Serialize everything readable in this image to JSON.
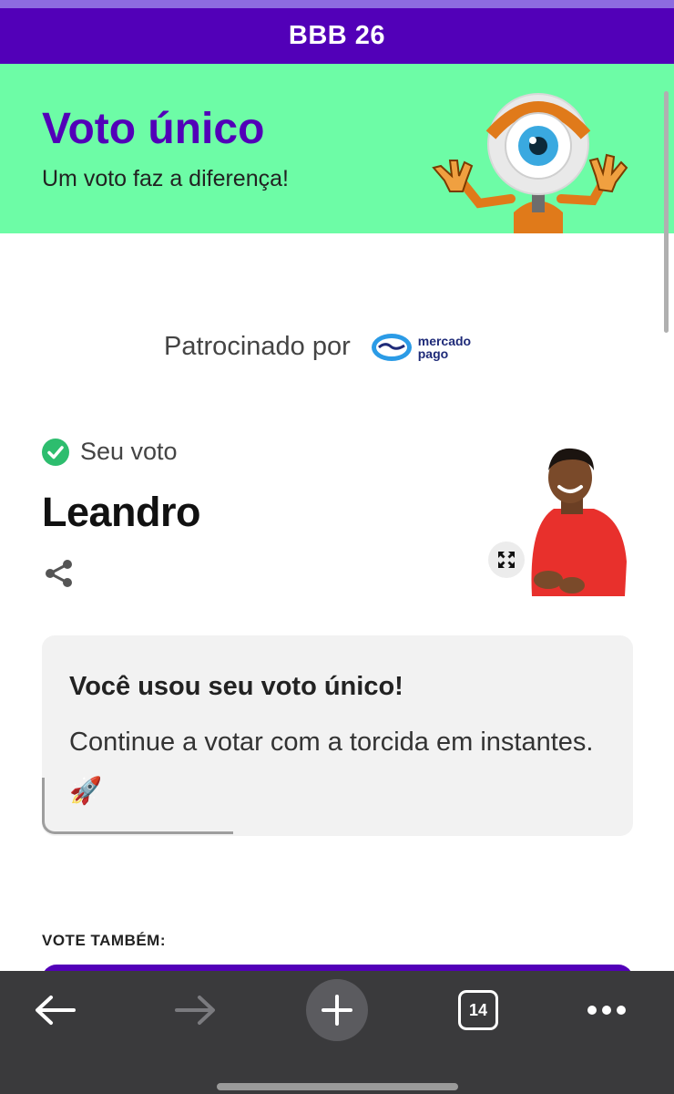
{
  "header": {
    "title": "BBB 26"
  },
  "hero": {
    "title": "Voto único",
    "subtitle": "Um voto faz a diferença!",
    "mascot_icon": "big-brother-eye-mascot"
  },
  "sponsor": {
    "label": "Patrocinado por",
    "logo_line1": "mercado",
    "logo_line2": "pago"
  },
  "vote": {
    "status_label": "Seu voto",
    "status_icon": "check-circle-icon",
    "candidate": "Leandro"
  },
  "notice": {
    "title": "Você usou seu voto único!",
    "body": "Continue a votar com a torcida em instantes. 🚀"
  },
  "vote_also": {
    "label": "VOTE TAMBÉM:"
  },
  "browser": {
    "tab_count": "14",
    "buttons": [
      "back-icon",
      "forward-icon",
      "new-tab-icon",
      "tabs-icon",
      "more-icon"
    ]
  },
  "colors": {
    "brand_purple": "#5200b8",
    "hero_green": "#6dfca6",
    "check_green": "#2dbd6e"
  }
}
